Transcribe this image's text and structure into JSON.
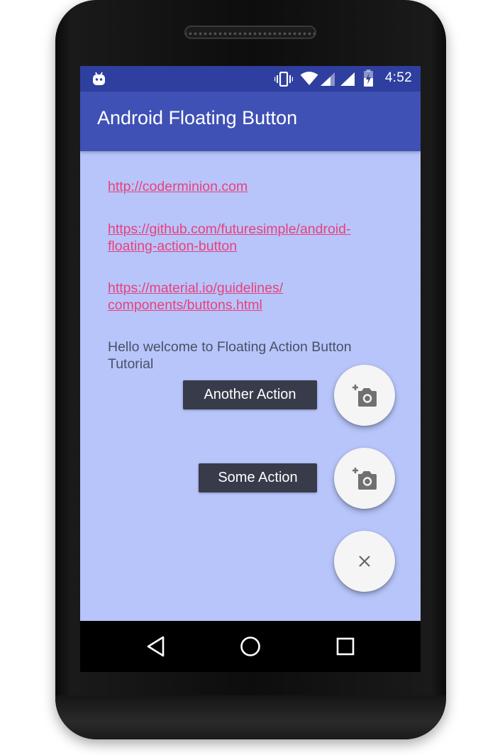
{
  "status_bar": {
    "time": "4:52",
    "icons": [
      "android-debug-icon",
      "vibrate-icon",
      "wifi-icon",
      "signal-icon",
      "signal-icon",
      "battery-charging-icon"
    ]
  },
  "app_bar": {
    "title": "Android Floating Button"
  },
  "content": {
    "links": [
      {
        "text": "http://coderminion.com"
      },
      {
        "line1": "https://github.com/futuresimple/android-",
        "line2": "floating-action-button"
      },
      {
        "line1": "https://material.io/guidelines/",
        "line2": "components/buttons.html"
      }
    ],
    "hello_line1": "Hello welcome to Floating Action Button",
    "hello_line2": "Tutorial"
  },
  "fab_menu": {
    "actions": [
      {
        "label": "Another Action",
        "icon": "add-a-photo-icon"
      },
      {
        "label": "Some Action",
        "icon": "add-a-photo-icon"
      }
    ],
    "main_icon": "close-icon"
  },
  "nav_bar": {
    "icons": [
      "back-icon",
      "home-icon",
      "recents-icon"
    ]
  },
  "colors": {
    "status_bar": "#2f3f9f",
    "app_bar": "#3f51b5",
    "background": "#b7c5fb",
    "link": "#e9417a",
    "chip": "#383b4a",
    "fab": "#f5f5f5"
  }
}
